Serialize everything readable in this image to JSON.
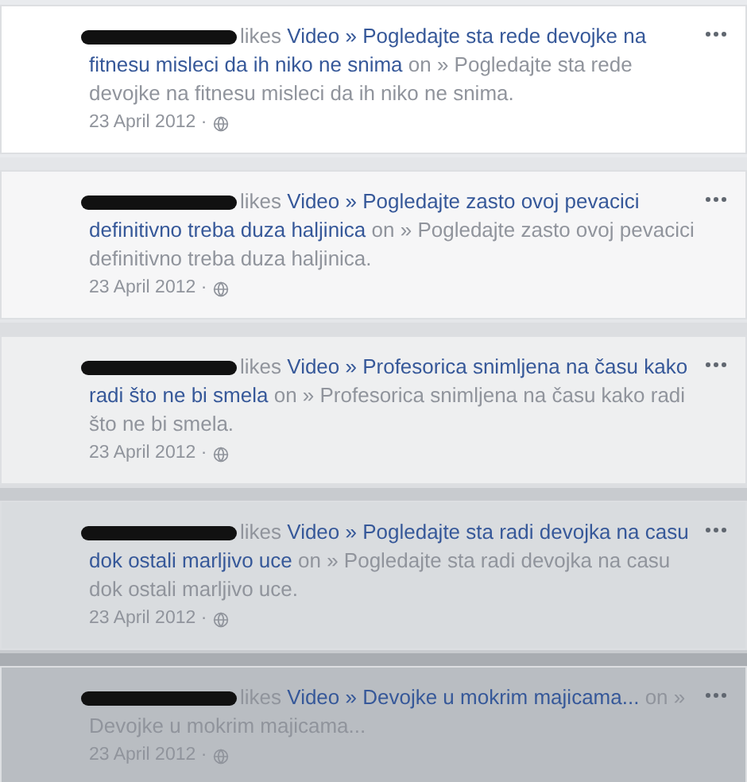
{
  "posts": [
    {
      "lines": [
        [
          {
            "kind": "verb",
            "text": "likes"
          },
          {
            "kind": "link",
            "text": "Video » Pogledajte sta rede devojke na"
          }
        ],
        [
          {
            "kind": "link",
            "text": "fitnesu misleci da ih niko ne snima"
          },
          {
            "kind": "plain",
            "text": "on » Pogledajte sta rede"
          }
        ],
        [
          {
            "kind": "plain",
            "text": "devojke na fitnesu misleci da ih niko ne snima."
          }
        ]
      ],
      "date": "23 April 2012 ·"
    },
    {
      "lines": [
        [
          {
            "kind": "verb",
            "text": "likes"
          },
          {
            "kind": "link",
            "text": "Video » Pogledajte zasto ovoj pevacici"
          }
        ],
        [
          {
            "kind": "link",
            "text": "definitivno treba duza haljinica"
          },
          {
            "kind": "plain",
            "text": "on » Pogledajte zasto ovoj pevacici"
          }
        ],
        [
          {
            "kind": "plain",
            "text": "definitivno treba duza haljinica."
          }
        ]
      ],
      "date": "23 April 2012 ·"
    },
    {
      "lines": [
        [
          {
            "kind": "verb",
            "text": "likes"
          },
          {
            "kind": "link",
            "text": "Video » Profesorica snimljena na času kako"
          }
        ],
        [
          {
            "kind": "link",
            "text": "radi što ne bi smela"
          },
          {
            "kind": "plain",
            "text": "on » Profesorica snimljena na času kako radi"
          }
        ],
        [
          {
            "kind": "plain",
            "text": "što ne bi smela."
          }
        ]
      ],
      "date": "23 April 2012 ·"
    },
    {
      "lines": [
        [
          {
            "kind": "verb",
            "text": "likes"
          },
          {
            "kind": "link",
            "text": "Video » Pogledajte sta radi devojka na casu"
          }
        ],
        [
          {
            "kind": "link",
            "text": "dok ostali marljivo uce"
          },
          {
            "kind": "plain",
            "text": "on » Pogledajte sta radi devojka na casu"
          }
        ],
        [
          {
            "kind": "plain",
            "text": "dok ostali marljivo uce."
          }
        ]
      ],
      "date": "23 April 2012 ·"
    },
    {
      "lines": [
        [
          {
            "kind": "verb",
            "text": "likes"
          },
          {
            "kind": "link",
            "text": "Video » Devojke u mokrim majicama..."
          },
          {
            "kind": "plain",
            "text": "on »"
          }
        ],
        [
          {
            "kind": "plain",
            "text": "Devojke u mokrim majicama..."
          }
        ]
      ],
      "date": "23 April 2012 ·"
    }
  ]
}
